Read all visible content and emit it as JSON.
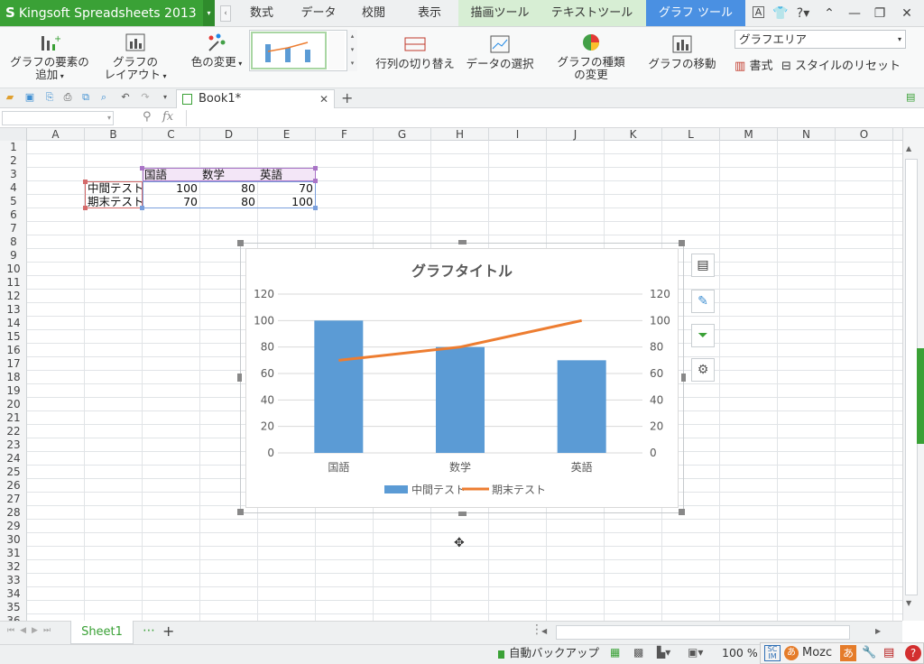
{
  "app": {
    "title": "Kingsoft Spreadsheets 2013",
    "logo": "S"
  },
  "tabs": [
    {
      "label": "数式"
    },
    {
      "label": "データ"
    },
    {
      "label": "校閲"
    },
    {
      "label": "表示"
    },
    {
      "label": "描画ツール"
    },
    {
      "label": "テキストツール"
    },
    {
      "label": "グラフ ツール"
    }
  ],
  "ribbon": {
    "add_element": "グラフの要素の\n追加",
    "layout": "グラフの\nレイアウト",
    "color_change": "色の変更",
    "swap_rowcol": "行列の切り替え",
    "select_data": "データの選択",
    "change_type": "グラフの種類\nの変更",
    "move_chart": "グラフの移動",
    "format": "書式",
    "reset_style": "スタイルのリセット",
    "area_select": "グラフエリア"
  },
  "document": {
    "tab_title": "Book1*"
  },
  "formula": {
    "fx": "fx"
  },
  "grid": {
    "columns": [
      "A",
      "B",
      "C",
      "D",
      "E",
      "F",
      "G",
      "H",
      "I",
      "J",
      "K",
      "L",
      "M",
      "N",
      "O"
    ],
    "rows": [
      "1",
      "2",
      "3",
      "4",
      "5",
      "6",
      "7",
      "8",
      "9",
      "10",
      "11",
      "12",
      "13",
      "14",
      "15",
      "16",
      "17",
      "18",
      "19",
      "20",
      "21",
      "22",
      "23",
      "24",
      "25",
      "26",
      "27",
      "28",
      "29",
      "30",
      "31",
      "32",
      "33",
      "34",
      "35",
      "36"
    ]
  },
  "cells": {
    "C3": "国語",
    "D3": "数学",
    "E3": "英語",
    "B4": "中間テスト",
    "C4": "100",
    "D4": "80",
    "E4": "70",
    "B5": "期末テスト",
    "C5": "70",
    "D5": "80",
    "E5": "100"
  },
  "sheets": [
    {
      "name": "Sheet1"
    }
  ],
  "status": {
    "backup": "自動バックアップ",
    "zoom": "100 %",
    "ime": "Mozc",
    "ime_mode": "あ"
  },
  "colors": {
    "brand": "#3aa136",
    "active_tab": "#4a90e2",
    "bar": "#5b9bd5",
    "line": "#ed7d31"
  },
  "chart_data": {
    "type": "bar",
    "title": "グラフタイトル",
    "categories": [
      "国語",
      "数学",
      "英語"
    ],
    "series": [
      {
        "name": "中間テスト",
        "type": "bar",
        "values": [
          100,
          80,
          70
        ]
      },
      {
        "name": "期末テスト",
        "type": "line",
        "values": [
          70,
          80,
          100
        ]
      }
    ],
    "ylim": [
      0,
      120
    ],
    "yticks": [
      0,
      20,
      40,
      60,
      80,
      100,
      120
    ],
    "secondary_ylim": [
      0,
      120
    ],
    "legend": "bottom",
    "grid": true
  }
}
